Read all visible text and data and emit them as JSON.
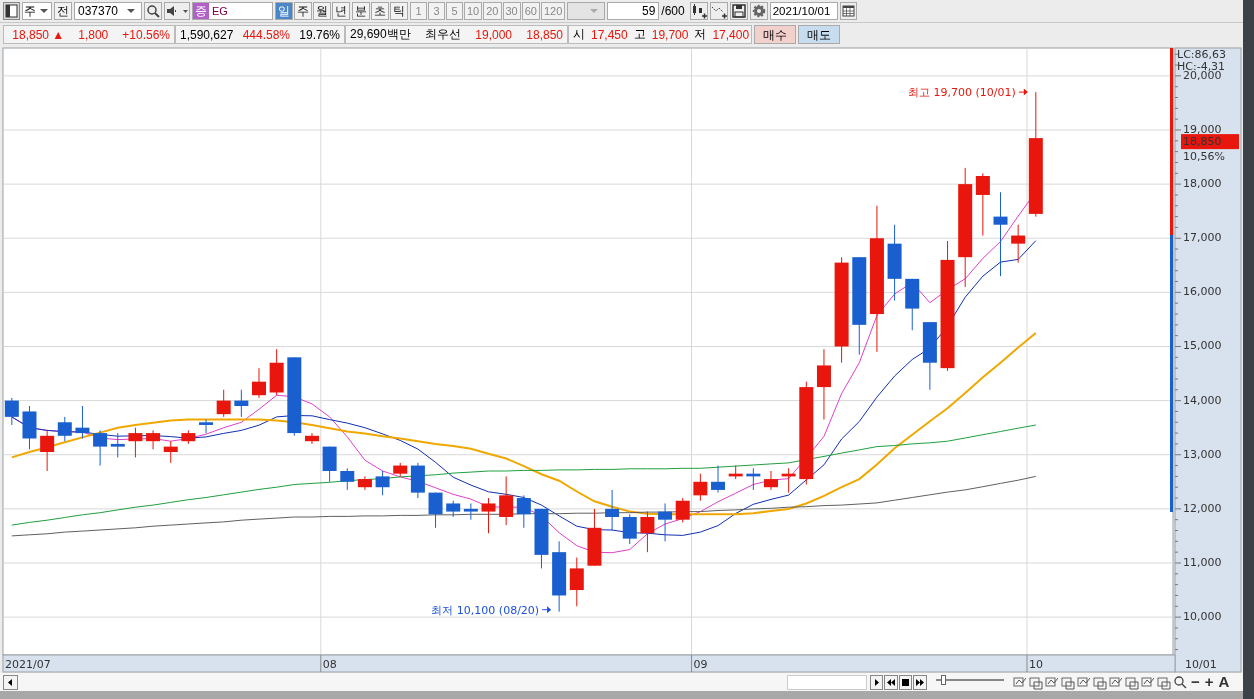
{
  "toolbar": {
    "view_dropdown": "주",
    "prev_button": "전",
    "code": "037370",
    "market_badge": "증",
    "stock_name": "EG",
    "period_tabs": [
      {
        "label": "일",
        "selected": true
      },
      {
        "label": "주",
        "selected": false
      },
      {
        "label": "월",
        "selected": false
      },
      {
        "label": "년",
        "selected": false
      }
    ],
    "unit_tabs": [
      {
        "label": "분",
        "selected": false
      },
      {
        "label": "초",
        "selected": false
      },
      {
        "label": "틱",
        "selected": false
      }
    ],
    "interval_buttons": [
      {
        "label": "1",
        "disabled": true
      },
      {
        "label": "3",
        "disabled": true
      },
      {
        "label": "5",
        "disabled": true
      },
      {
        "label": "10",
        "disabled": true
      },
      {
        "label": "20",
        "disabled": true
      },
      {
        "label": "30",
        "disabled": true
      },
      {
        "label": "60",
        "disabled": true
      },
      {
        "label": "120",
        "disabled": true
      }
    ],
    "count": "59",
    "count_max": "/600",
    "date": "2021/10/01"
  },
  "quote_bar": {
    "groups": [
      [
        {
          "text": "18,850 ▲",
          "kind": "up"
        },
        {
          "text": "1,800",
          "kind": "up"
        },
        {
          "text": "+10.56%",
          "kind": "up"
        }
      ],
      [
        {
          "text": "1,590,627",
          "kind": "plain"
        },
        {
          "text": "444.58%",
          "kind": "up"
        },
        {
          "text": "19.76%",
          "kind": "plain"
        }
      ],
      [
        {
          "text": "29,690백만",
          "kind": "plain"
        },
        {
          "text": "최우선",
          "kind": "plain"
        },
        {
          "text": "19,000",
          "kind": "up"
        },
        {
          "text": "18,850",
          "kind": "up"
        }
      ],
      [
        {
          "text": "시",
          "kind": "plain"
        },
        {
          "text": "17,450",
          "kind": "up"
        },
        {
          "text": "고",
          "kind": "plain"
        },
        {
          "text": "19,700",
          "kind": "up"
        },
        {
          "text": "저",
          "kind": "plain"
        },
        {
          "text": "17,400",
          "kind": "up"
        }
      ]
    ],
    "buttons": [
      {
        "label": "매수",
        "kind": "buy"
      },
      {
        "label": "매도",
        "kind": "sell"
      }
    ]
  },
  "chart": {
    "lc": "LC:86,63",
    "hc": "HC:-4,31",
    "price_label": "18,850",
    "change_label": "10,56%",
    "price_axis": [
      "20,000",
      "19,000",
      "18,000",
      "17,000",
      "16,000",
      "15,000",
      "14,000",
      "13,000",
      "12,000",
      "11,000",
      "10,000"
    ],
    "time_axis": [
      "2021/07",
      "08",
      "09",
      "10"
    ],
    "last_date": "10/01",
    "annotations": [
      {
        "text": "최고 19,700 (10/01)",
        "kind": "high"
      },
      {
        "text": "최저 10,100 (08/20)",
        "kind": "low"
      }
    ]
  },
  "bottom_bar": {
    "slider": {
      "level": 0.12
    },
    "text_buttons": [
      "−",
      "+",
      "A"
    ]
  }
}
